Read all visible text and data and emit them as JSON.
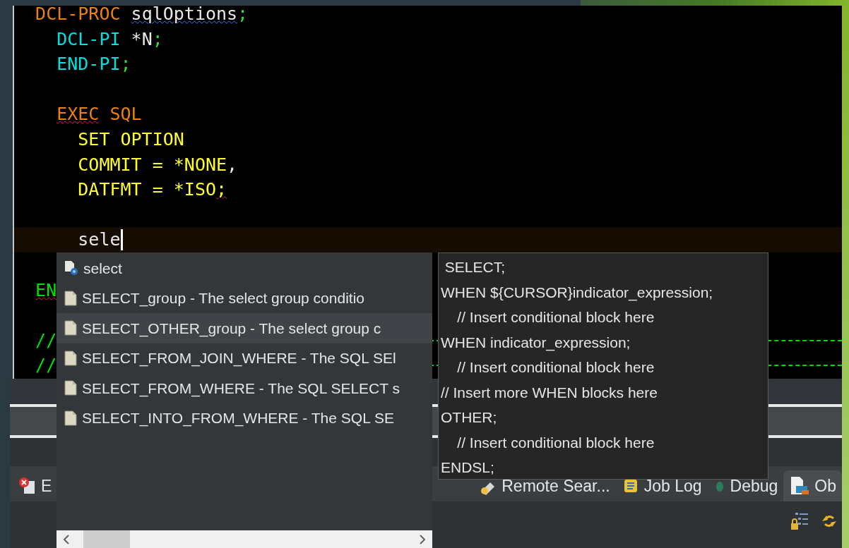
{
  "editor": {
    "lines": [
      {
        "tokens": [
          {
            "text": "  DCL-PROC",
            "kind": "keyword"
          },
          {
            "text": " sqlOptions",
            "kind": "name",
            "warning": true
          },
          {
            "text": ";",
            "kind": "punct"
          }
        ]
      },
      {
        "tokens": [
          {
            "text": "    DCL-PI",
            "kind": "decl"
          },
          {
            "text": " *N",
            "kind": "plain"
          },
          {
            "text": ";",
            "kind": "punct"
          }
        ]
      },
      {
        "tokens": [
          {
            "text": "    END-PI",
            "kind": "decl"
          },
          {
            "text": ";",
            "kind": "punct"
          }
        ]
      },
      {
        "kind": "blank"
      },
      {
        "tokens": [
          {
            "text": "    EXEC",
            "kind": "keyword",
            "error": true
          },
          {
            "text": " SQL",
            "kind": "keyword"
          }
        ]
      },
      {
        "tokens": [
          {
            "text": "      SET OPTION",
            "kind": "sql"
          }
        ]
      },
      {
        "tokens": [
          {
            "text": "      COMMIT = *NONE",
            "kind": "sql"
          },
          {
            "text": ",",
            "kind": "plain"
          }
        ]
      },
      {
        "tokens": [
          {
            "text": "      DATFMT = *ISO",
            "kind": "sql"
          },
          {
            "text": ";",
            "kind": "sql",
            "error": true
          }
        ]
      },
      {
        "kind": "blank"
      },
      {
        "current": true,
        "tokens": [
          {
            "text": "      sele",
            "kind": "plain"
          }
        ]
      },
      {
        "kind": "blank"
      },
      {
        "tokens": [
          {
            "text": "  EN",
            "kind": "comment",
            "error": true
          }
        ]
      },
      {
        "kind": "blank"
      },
      {
        "kind": "divider",
        "tokens": [
          {
            "text": "  //",
            "kind": "comment"
          }
        ]
      },
      {
        "kind": "divider",
        "tokens": [
          {
            "text": "  //",
            "kind": "comment"
          }
        ]
      }
    ]
  },
  "completion": {
    "items": [
      {
        "label": "select",
        "kind": "keyword",
        "selected": false
      },
      {
        "label": "SELECT_group - The select group conditio",
        "kind": "template",
        "selected": false
      },
      {
        "label": "SELECT_OTHER_group - The select group c",
        "kind": "template",
        "selected": true
      },
      {
        "label": "SELECT_FROM_JOIN_WHERE - The SQL SEl",
        "kind": "template",
        "selected": false
      },
      {
        "label": "SELECT_FROM_WHERE - The SQL SELECT s",
        "kind": "template",
        "selected": false
      },
      {
        "label": "SELECT_INTO_FROM_WHERE - The SQL SE",
        "kind": "template",
        "selected": false
      }
    ]
  },
  "preview": {
    "lines": [
      " SELECT;",
      "WHEN ${CURSOR}indicator_expression;",
      "    // Insert conditional block here",
      "WHEN indicator_expression;",
      "    // Insert conditional block here",
      "// Insert more WHEN blocks here",
      "OTHER;",
      "    // Insert conditional block here",
      "ENDSL;"
    ]
  },
  "panel": {
    "tabs": [
      {
        "label": "E",
        "selected": false
      },
      {
        "label": "Remote Sear...",
        "selected": false
      },
      {
        "label": "Job Log",
        "selected": false
      },
      {
        "label": "Debug",
        "selected": false
      },
      {
        "label": "Ob",
        "selected": true
      }
    ]
  }
}
